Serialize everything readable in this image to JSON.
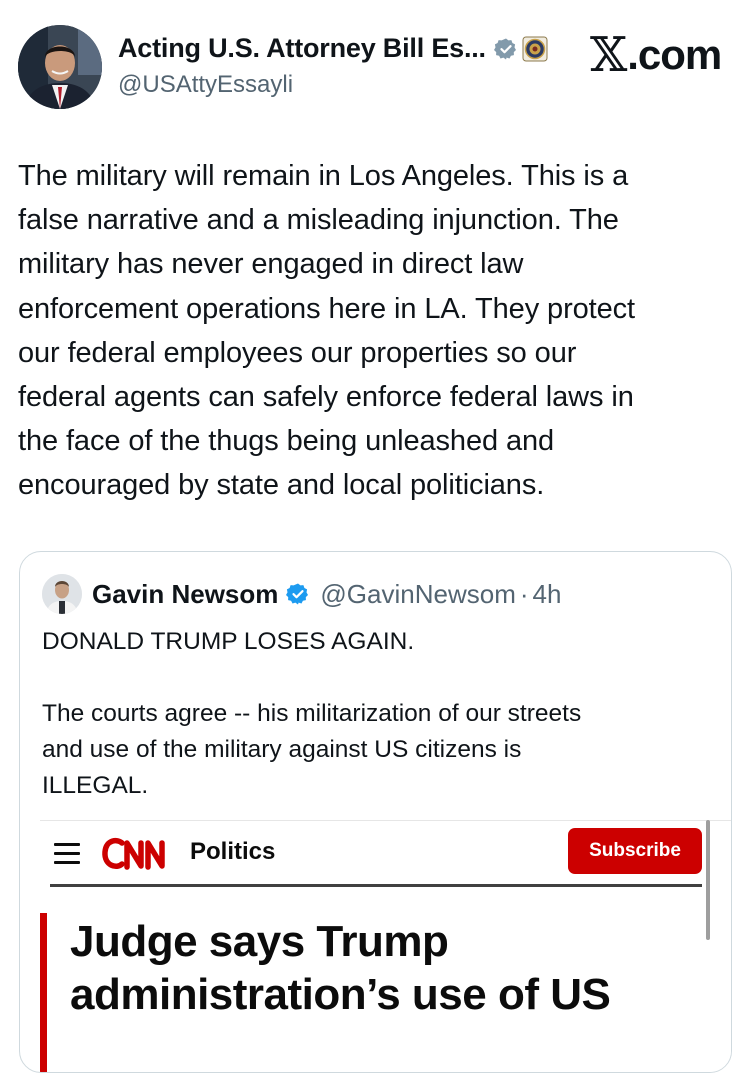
{
  "author": {
    "display_name": "Acting U.S. Attorney Bill Es...",
    "handle": "@USAttyEssayli",
    "verified_icon": "verified-badge-icon",
    "affiliation_icon": "doj-seal-icon",
    "verified_color": "#829aab"
  },
  "source_label": {
    "x_glyph": "𝕏",
    "suffix": ".com"
  },
  "tweet": {
    "text": "The military will remain in Los Angeles. This is a\nfalse narrative and a misleading injunction. The\nmilitary has never engaged in direct law\nenforcement operations here in LA. They protect\nour federal employees our properties so our\nfederal agents can safely enforce federal laws in\nthe face of the thugs being unleashed and\nencouraged by state and local politicians."
  },
  "quoted_tweet": {
    "display_name": "Gavin Newsom",
    "handle": "@GavinNewsom",
    "separator": "·",
    "time": "4h",
    "verified_color": "#1d9bf0",
    "text": "DONALD TRUMP LOSES AGAIN.\n\nThe courts agree -- his militarization of our streets\nand use of the military against US citizens is\nILLEGAL."
  },
  "article": {
    "brand": "CNN",
    "section": "Politics",
    "subscribe_label": "Subscribe",
    "brand_color": "#cc0000",
    "headline": "Judge says Trump administration’s use of US"
  }
}
